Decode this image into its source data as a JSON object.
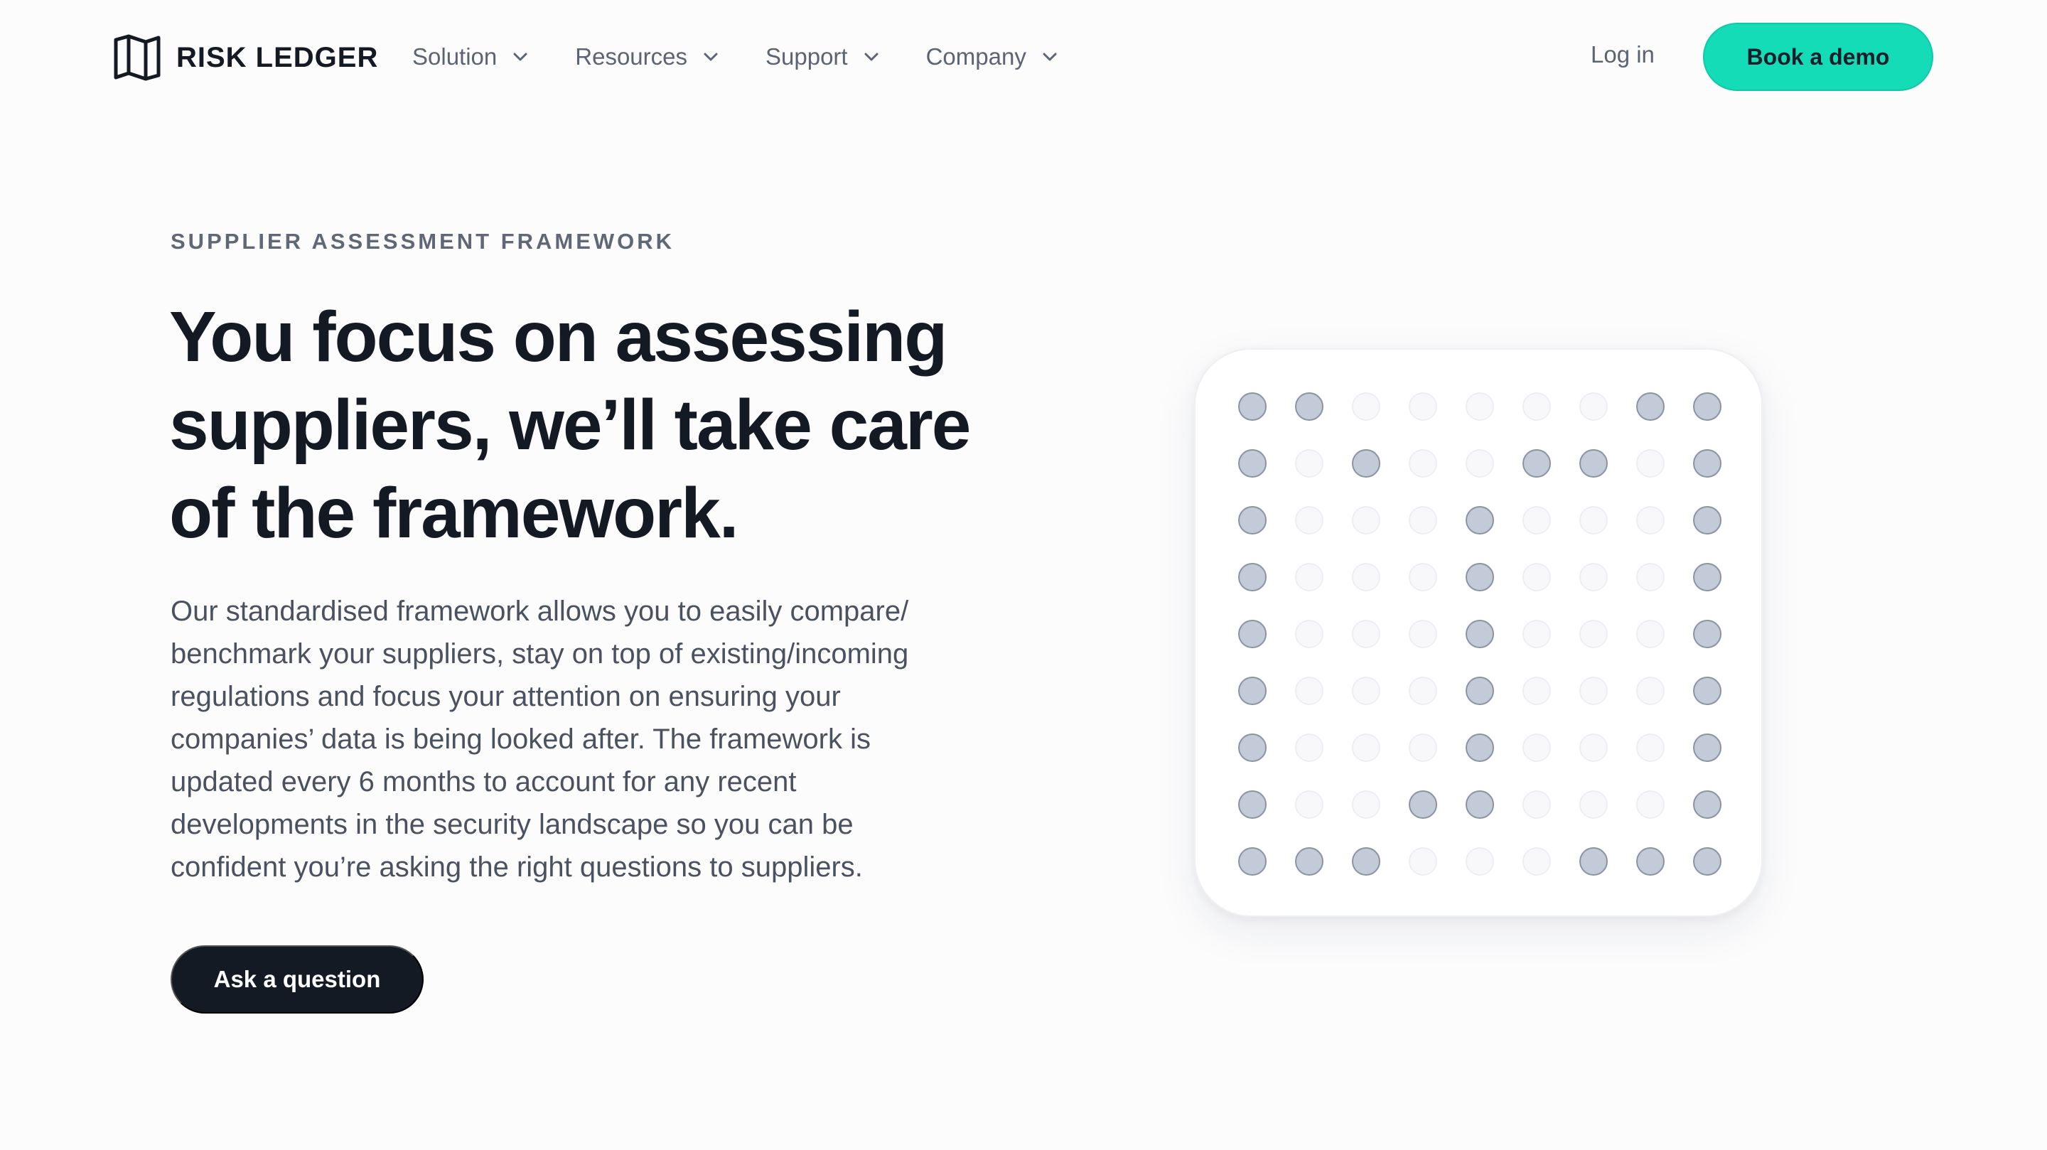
{
  "header": {
    "logo_text": "RISK LEDGER",
    "nav": [
      {
        "label": "Solution",
        "icon": "chevron-down-icon"
      },
      {
        "label": "Resources",
        "icon": "chevron-down-icon"
      },
      {
        "label": "Support",
        "icon": "chevron-down-icon"
      },
      {
        "label": "Company",
        "icon": "chevron-down-icon"
      }
    ],
    "login_label": "Log in",
    "demo_label": "Book a demo"
  },
  "hero": {
    "eyebrow": "SUPPLIER ASSESSMENT FRAMEWORK",
    "headline_lines": [
      "You focus on assessing",
      "suppliers, we’ll take care",
      "of the framework."
    ],
    "body_lines": [
      "Our standardised framework allows you to easily compare/",
      "benchmark your suppliers, stay on top of existing/incoming",
      "regulations and focus your attention on ensuring your",
      "companies’ data is being looked after. The framework is",
      "updated every 6 months to account for any recent",
      "developments in the security landscape so you can be",
      "confident you’re asking the right questions to suppliers."
    ],
    "cta_label": "Ask a question"
  },
  "dot_grid": {
    "filled_color": "#c4cbd8",
    "filled_stroke": "#8a93a4",
    "empty_color": "#f8f8fb",
    "empty_stroke": "#eceef3",
    "rows": [
      [
        1,
        1,
        0,
        0,
        0,
        0,
        0,
        1,
        1
      ],
      [
        1,
        0,
        1,
        0,
        0,
        1,
        1,
        0,
        1
      ],
      [
        1,
        0,
        0,
        0,
        1,
        0,
        0,
        0,
        1
      ],
      [
        1,
        0,
        0,
        0,
        1,
        0,
        0,
        0,
        1
      ],
      [
        1,
        0,
        0,
        0,
        1,
        0,
        0,
        0,
        1
      ],
      [
        1,
        0,
        0,
        0,
        1,
        0,
        0,
        0,
        1
      ],
      [
        1,
        0,
        0,
        0,
        1,
        0,
        0,
        0,
        1
      ],
      [
        1,
        0,
        0,
        1,
        1,
        0,
        0,
        0,
        1
      ],
      [
        1,
        1,
        1,
        0,
        0,
        0,
        1,
        1,
        1
      ]
    ]
  },
  "colors": {
    "accent": "#14dcb7",
    "dark": "#141a24"
  }
}
